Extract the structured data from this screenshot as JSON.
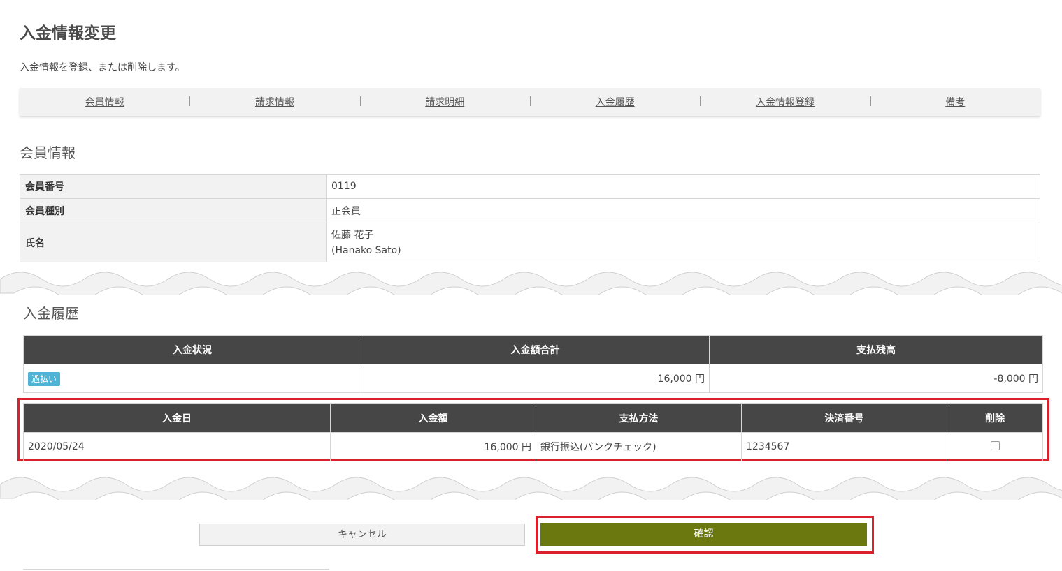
{
  "page": {
    "title": "入金情報変更",
    "description": "入金情報を登録、または削除します。"
  },
  "subnav": [
    "会員情報",
    "請求情報",
    "請求明細",
    "入金履歴",
    "入金情報登録",
    "備考"
  ],
  "member_section": {
    "title": "会員情報",
    "rows": [
      {
        "label": "会員番号",
        "value": "0119"
      },
      {
        "label": "会員種別",
        "value": "正会員"
      },
      {
        "label": "氏名",
        "value": "佐藤 花子",
        "value2": "(Hanako Sato)"
      }
    ]
  },
  "payment_section": {
    "title": "入金履歴",
    "summary_headers": [
      "入金状況",
      "入金額合計",
      "支払残高"
    ],
    "summary": {
      "status_badge": "過払い",
      "total": "16,000 円",
      "balance": "-8,000 円"
    },
    "detail_headers": [
      "入金日",
      "入金額",
      "支払方法",
      "決済番号",
      "削除"
    ],
    "detail_rows": [
      {
        "date": "2020/05/24",
        "amount": "16,000 円",
        "method": "銀行振込(バンクチェック)",
        "payment_no": "1234567",
        "delete_checked": false
      }
    ]
  },
  "buttons": {
    "cancel": "キャンセル",
    "confirm": "確認"
  },
  "colors": {
    "accent_confirm": "#6b780f",
    "highlight": "#d9202c",
    "badge": "#4fb3d6",
    "header_dark": "#464646"
  }
}
